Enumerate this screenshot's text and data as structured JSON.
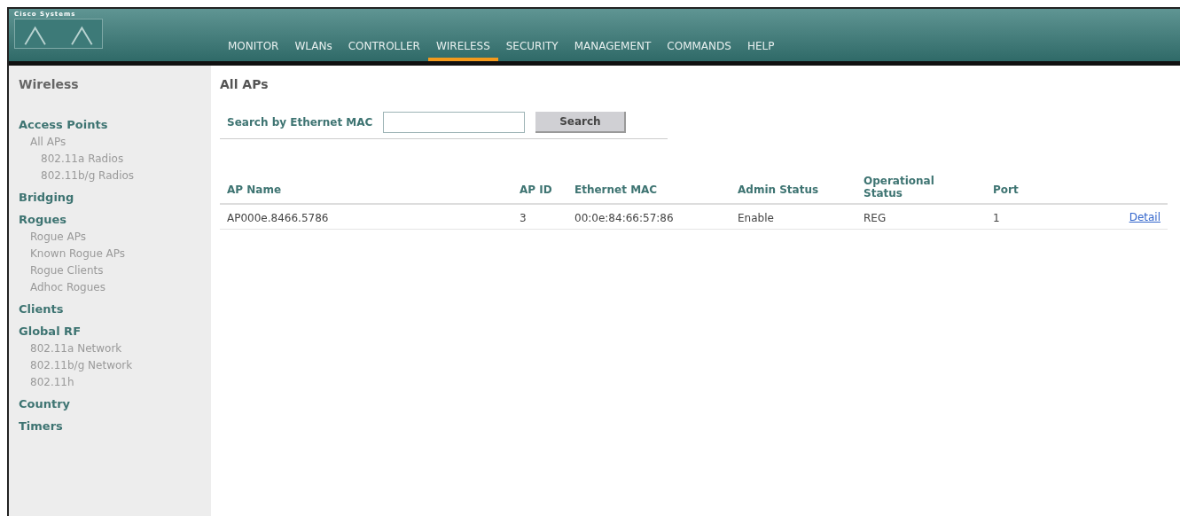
{
  "header": {
    "logo_text": "Cisco Systems",
    "menu": [
      {
        "label": "MONITOR",
        "selected": false
      },
      {
        "label": "WLANs",
        "selected": false
      },
      {
        "label": "CONTROLLER",
        "selected": false
      },
      {
        "label": "WIRELESS",
        "selected": true
      },
      {
        "label": "SECURITY",
        "selected": false
      },
      {
        "label": "MANAGEMENT",
        "selected": false
      },
      {
        "label": "COMMANDS",
        "selected": false
      },
      {
        "label": "HELP",
        "selected": false
      }
    ]
  },
  "sidebar": {
    "title": "Wireless",
    "sections": [
      {
        "label": "Access Points",
        "children": [
          {
            "label": "All APs",
            "children": [
              {
                "label": "802.11a Radios"
              },
              {
                "label": "802.11b/g Radios"
              }
            ]
          }
        ]
      },
      {
        "label": "Bridging"
      },
      {
        "label": "Rogues",
        "children": [
          {
            "label": "Rogue APs"
          },
          {
            "label": "Known Rogue APs"
          },
          {
            "label": "Rogue Clients"
          },
          {
            "label": "Adhoc Rogues"
          }
        ]
      },
      {
        "label": "Clients"
      },
      {
        "label": "Global RF",
        "children": [
          {
            "label": "802.11a Network"
          },
          {
            "label": "802.11b/g Network"
          },
          {
            "label": "802.11h"
          }
        ]
      },
      {
        "label": "Country"
      },
      {
        "label": "Timers"
      }
    ]
  },
  "main": {
    "title": "All APs",
    "search": {
      "label": "Search by Ethernet MAC",
      "button": "Search"
    },
    "table": {
      "columns": [
        "AP Name",
        "AP ID",
        "Ethernet MAC",
        "Admin Status",
        "Operational Status",
        "Port"
      ],
      "rows": [
        {
          "cells": [
            "AP000e.8466.5786",
            "3",
            "00:0e:84:66:57:86",
            "Enable",
            "REG",
            "1"
          ],
          "link": "Detail"
        }
      ]
    }
  }
}
